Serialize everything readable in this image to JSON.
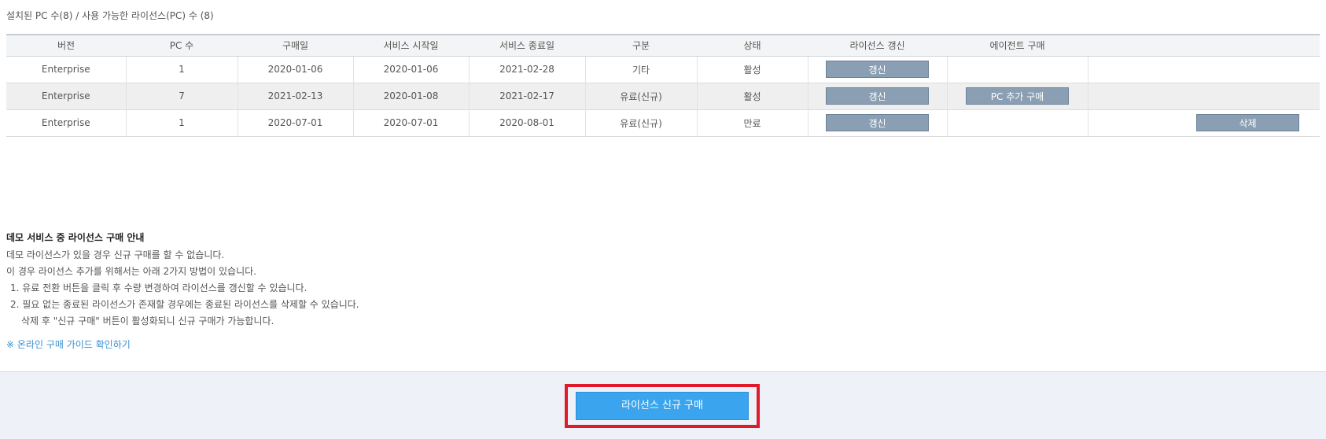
{
  "summary": "설치된 PC 수(8) / 사용 가능한 라이선스(PC) 수 (8)",
  "table": {
    "headers": [
      "버전",
      "PC 수",
      "구매일",
      "서비스 시작일",
      "서비스 종료일",
      "구분",
      "상태",
      "라이선스 갱신",
      "에이전트 구매",
      ""
    ],
    "rows": [
      {
        "version": "Enterprise",
        "pc_count": "1",
        "purchase_date": "2020-01-06",
        "start_date": "2020-01-06",
        "end_date": "2021-02-28",
        "type": "기타",
        "status": "활성",
        "renew_label": "갱신",
        "agent_label": "",
        "delete_label": ""
      },
      {
        "version": "Enterprise",
        "pc_count": "7",
        "purchase_date": "2021-02-13",
        "start_date": "2020-01-08",
        "end_date": "2021-02-17",
        "type": "유료(신규)",
        "status": "활성",
        "renew_label": "갱신",
        "agent_label": "PC 추가 구매",
        "delete_label": ""
      },
      {
        "version": "Enterprise",
        "pc_count": "1",
        "purchase_date": "2020-07-01",
        "start_date": "2020-07-01",
        "end_date": "2020-08-01",
        "type": "유료(신규)",
        "status": "만료",
        "renew_label": "갱신",
        "agent_label": "",
        "delete_label": "삭제"
      }
    ]
  },
  "guide": {
    "title": "데모 서비스 중 라이선스 구매 안내",
    "line1": "데모 라이선스가 있을 경우 신규 구매를 할 수 없습니다.",
    "line2": "이 경우 라이선스 추가를 위해서는 아래 2가지 방법이 있습니다.",
    "item1": "1. 유료 전환 버튼을 클릭 후 수량 변경하여 라이선스를 갱신할 수 있습니다.",
    "item2": "2. 필요 없는 종료된 라이선스가 존재할 경우에는 종료된 라이선스를 삭제할 수 있습니다.",
    "item2_sub": "삭제 후 \"신규 구매\" 버튼이 활성화되니 신규 구매가 가능합니다.",
    "link": "※ 온라인 구매 가이드 확인하기"
  },
  "actions": {
    "new_purchase_label": "라이선스 신규 구매"
  },
  "colors": {
    "table_button": "#8a9fb3",
    "primary_button": "#3aa5ee",
    "highlight": "#e0192b",
    "link": "#3a8fd0"
  }
}
